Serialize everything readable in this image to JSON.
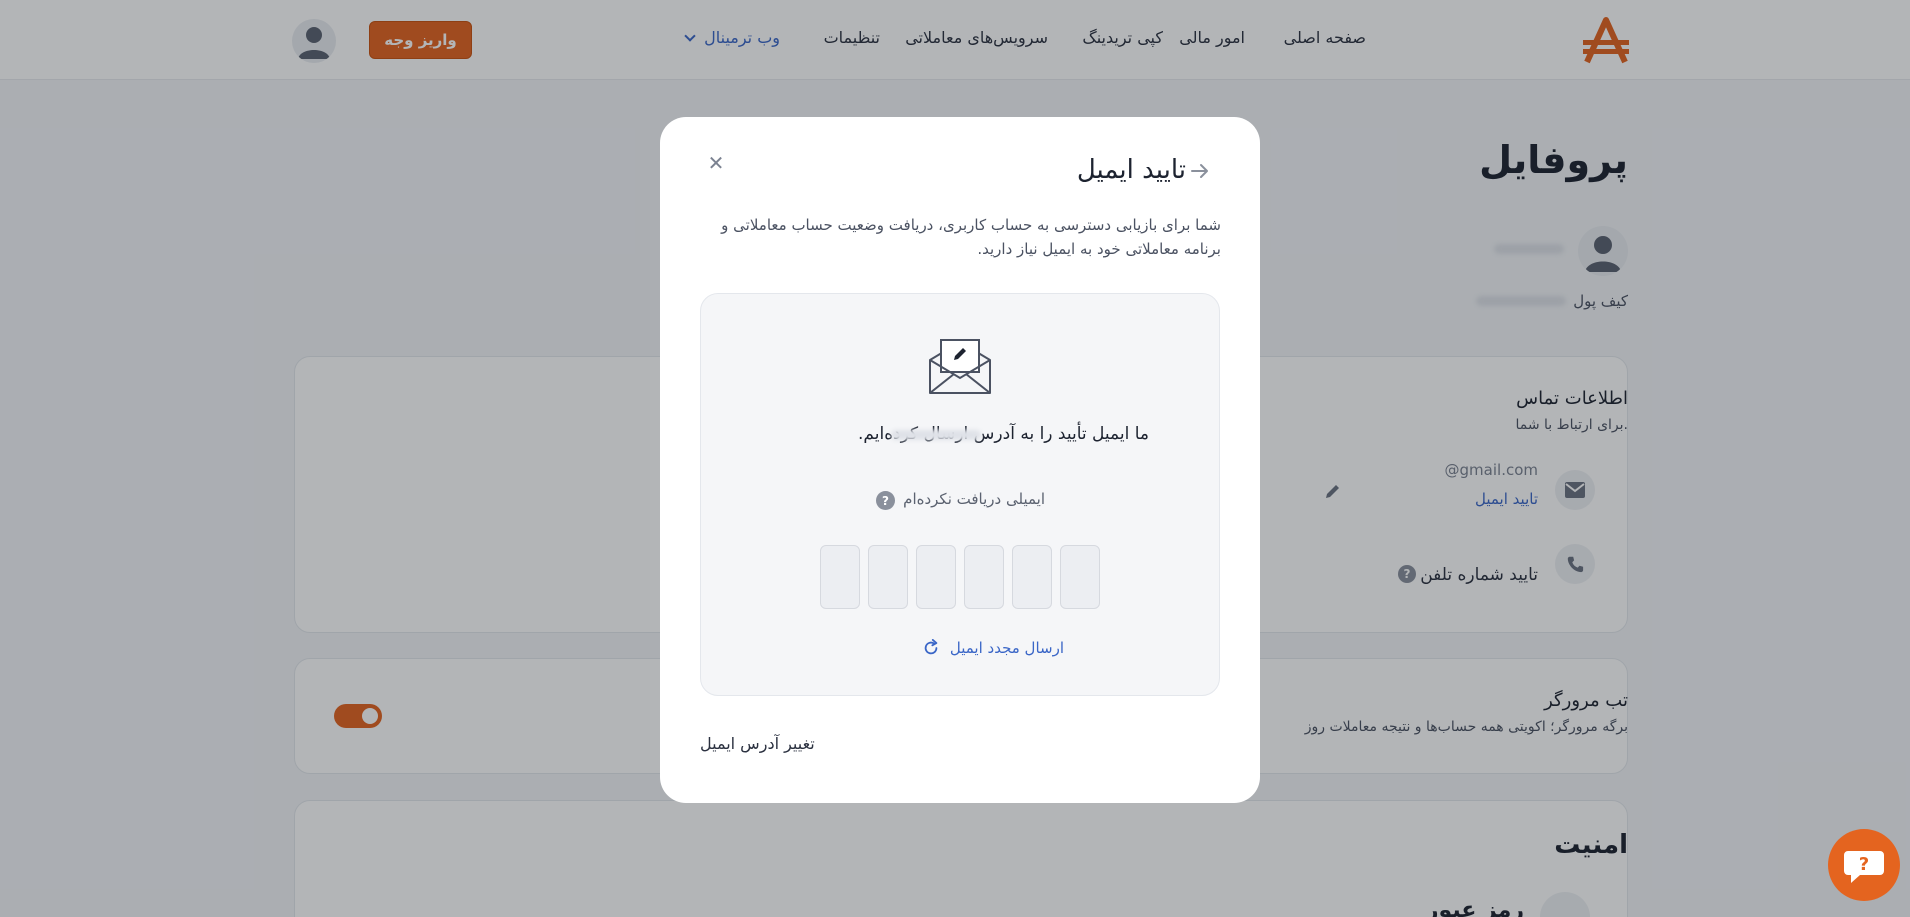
{
  "header": {
    "nav": {
      "home": "صفحه اصلی",
      "finance": "امور مالی",
      "copy_trading": "کپی تریدینگ",
      "trading_services": "سرویس‌های معاملاتی",
      "settings": "تنظیمات",
      "web_terminal": "وب ترمینال"
    },
    "deposit_label": "واریز وجه"
  },
  "page": {
    "title": "پروفایل",
    "wallet_label": "کیف پول",
    "contact": {
      "title": "اطلاعات تماس",
      "subtitle": "برای ارتباط با شما.",
      "email_value": "@gmail.com",
      "email_verify_link": "تایید ایمیل",
      "phone_verify": "تایید شماره تلفن"
    },
    "browser_tab": {
      "title": "تب مرورگر",
      "subtitle": "برگه مرورگر؛ اکویتی همه حساب‌ها و نتیجه معاملات روز"
    },
    "security": {
      "title": "امنیت",
      "password_label": "رمز عبور"
    }
  },
  "modal": {
    "title": "تایید ایمیل",
    "description": "شما برای بازیابی دسترسی به حساب کاربری، دریافت وضعیت حساب معاملاتی و برنامه معاملاتی خود به ایمیل نیاز دارید.",
    "sent_message": "ما ایمیل تأیید را به آدرس ارسال کرده‌ایم.",
    "not_received": "ایمیلی دریافت نکرده‌ام",
    "resend": "ارسال مجدد ایمیل",
    "change_email": "تغییر آدرس ایمیل",
    "code_length": 6
  },
  "colors": {
    "accent": "#e4641f",
    "link": "#3a66c7"
  },
  "icons": [
    "logo-icon",
    "chevron-down-icon",
    "user-avatar-icon",
    "mail-icon",
    "phone-icon",
    "pencil-icon",
    "help-icon",
    "close-icon",
    "arrow-right-icon",
    "envelope-icon",
    "refresh-icon",
    "support-question-icon"
  ]
}
